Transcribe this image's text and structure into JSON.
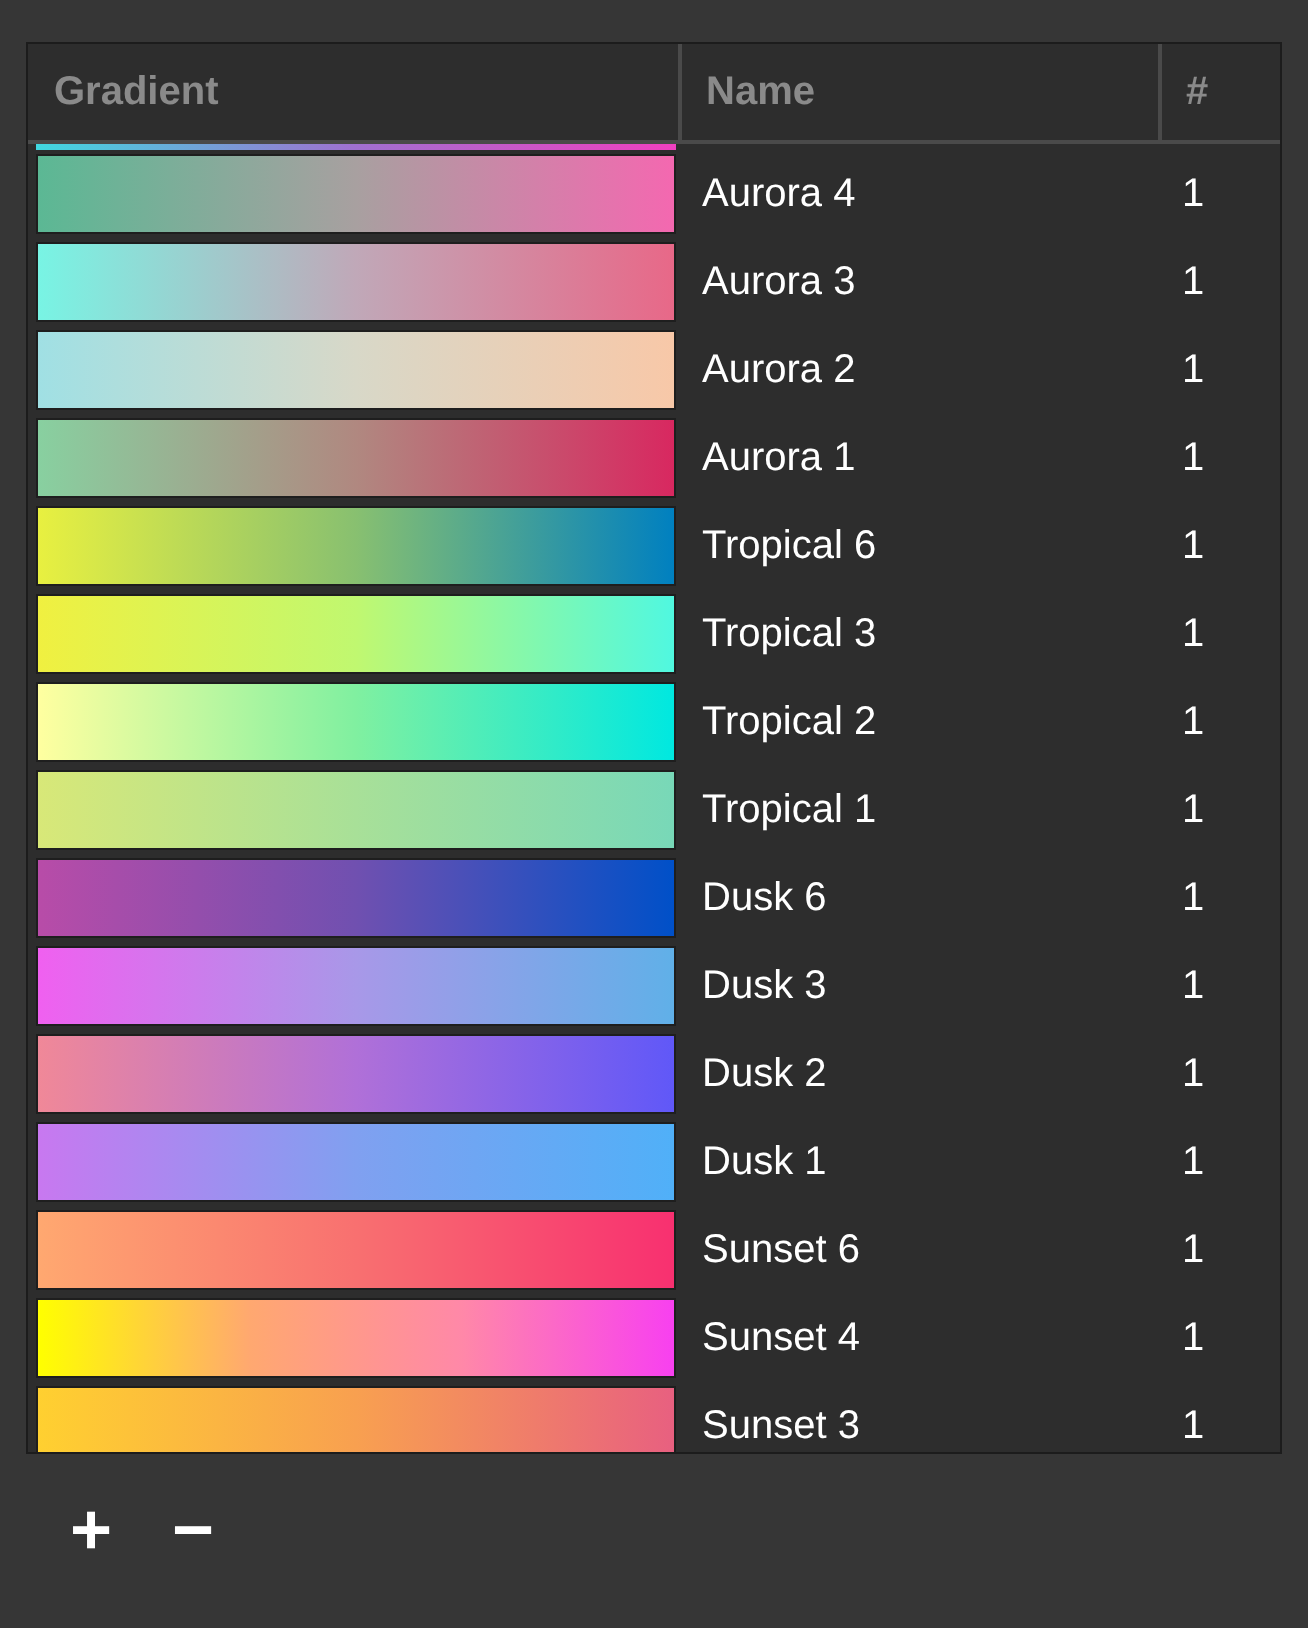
{
  "table": {
    "columns": [
      "Gradient",
      "Name",
      "#"
    ],
    "rows": [
      {
        "name": "Aurora 4",
        "count": "1"
      },
      {
        "name": "Aurora 3",
        "count": "1"
      },
      {
        "name": "Aurora 2",
        "count": "1"
      },
      {
        "name": "Aurora 1",
        "count": "1"
      },
      {
        "name": "Tropical 6",
        "count": "1"
      },
      {
        "name": "Tropical 3",
        "count": "1"
      },
      {
        "name": "Tropical 2",
        "count": "1"
      },
      {
        "name": "Tropical 1",
        "count": "1"
      },
      {
        "name": "Dusk 6",
        "count": "1"
      },
      {
        "name": "Dusk 3",
        "count": "1"
      },
      {
        "name": "Dusk 2",
        "count": "1"
      },
      {
        "name": "Dusk 1",
        "count": "1"
      },
      {
        "name": "Sunset 6",
        "count": "1"
      },
      {
        "name": "Sunset 4",
        "count": "1"
      },
      {
        "name": "Sunset 3",
        "count": "1"
      }
    ]
  },
  "buttons": [
    "+",
    "−"
  ]
}
